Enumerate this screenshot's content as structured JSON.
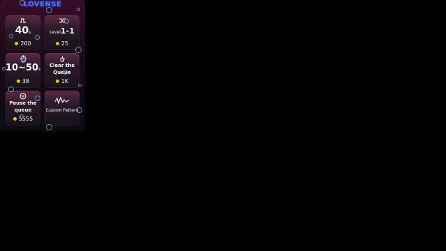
{
  "brand": "LOVENSE",
  "cards": [
    {
      "name": "time",
      "icon": "pulse-icon",
      "value": "40",
      "unit": "s",
      "price": "200"
    },
    {
      "name": "level",
      "icon": "shuffle-icon",
      "value_prefix": "Level",
      "value": "1-1",
      "price": "25"
    },
    {
      "name": "random-time",
      "icon": "timer-icon",
      "value": "10~50",
      "unit": "s",
      "price": "38"
    },
    {
      "name": "clear-queue",
      "icon": "sweep-icon",
      "title": "Clear the Queue",
      "price": "1K"
    },
    {
      "name": "pause-queue",
      "icon": "pause-icon",
      "title": "Pause the queue",
      "price": "5555"
    },
    {
      "name": "custom-pattern",
      "icon": "wave-icon",
      "label": "Custom Pattern"
    }
  ],
  "colors": {
    "accent": "#3a7bff",
    "coin": "#f2c200",
    "bubble": "#6fa0d8"
  }
}
